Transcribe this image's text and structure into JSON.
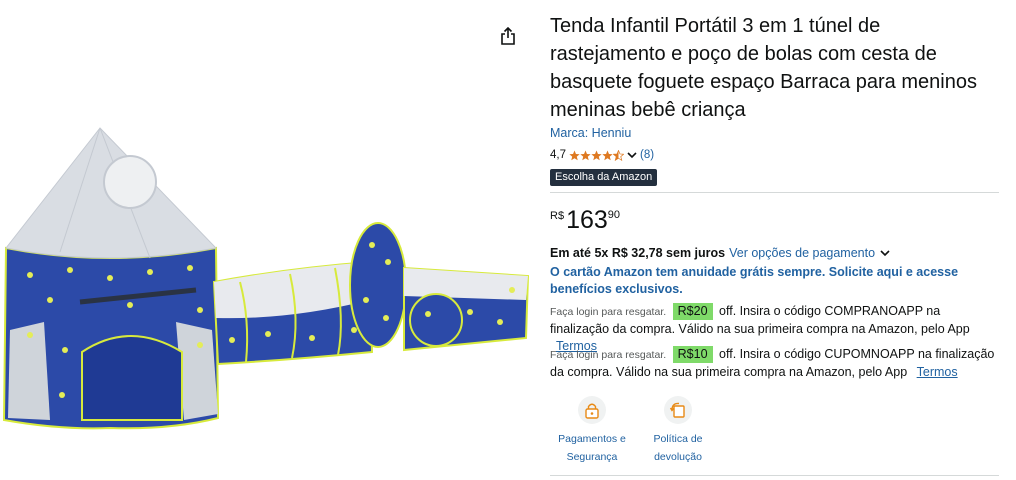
{
  "product": {
    "title": "Tenda Infantil Portátil 3 em 1 túnel de rastejamento e poço de bolas com cesta de basquete foguete espaço Barraca para meninos meninas bebê criança",
    "brand_label": "Marca: Henniu",
    "rating": {
      "value": "4,7",
      "stars": 4.7,
      "count_label": "(8)"
    },
    "badge": "Escolha da Amazon"
  },
  "price": {
    "currency": "R$",
    "whole": "163",
    "fraction": "90"
  },
  "installments": {
    "text": "Em até 5x R$ 32,78 sem juros",
    "link": "Ver opções de pagamento"
  },
  "card_promo": "O cartão Amazon tem anuidade grátis sempre. Solicite aqui e acesse benefícios exclusivos.",
  "coupons": [
    {
      "login_label": "Faça login para resgatar.",
      "amount": "R$20",
      "text": "off. Insira o código COMPRANOAPP na finalização da compra. Válido na sua primeira compra na Amazon, pelo App",
      "terms": "Termos"
    },
    {
      "login_label": "Faça login para resgatar.",
      "amount": "R$10",
      "text": "off. Insira o código CUPOMNOAPP na finalização da compra. Válido na sua primeira compra na Amazon, pelo App",
      "terms": "Termos"
    }
  ],
  "features": [
    {
      "label_line1": "Pagamentos e",
      "label_line2": "Segurança",
      "icon": "payment-security-icon"
    },
    {
      "label_line1": "Política de",
      "label_line2": "devolução",
      "icon": "return-policy-icon"
    }
  ],
  "colors": {
    "link": "#2162a1",
    "text": "#0f1111",
    "star": "#de7921",
    "coupon_badge": "#7fda69",
    "choice_badge_bg": "#232f3e",
    "tent_blue": "#2c4aa8",
    "tent_silver": "#d9dde3",
    "tent_trim": "#d7ea3c"
  }
}
